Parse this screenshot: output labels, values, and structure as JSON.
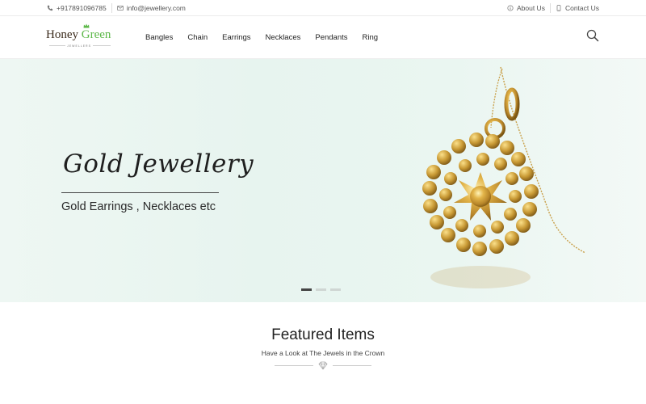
{
  "topbar": {
    "phone": "+917891096785",
    "email": "info@jewellery.com",
    "about": "About Us",
    "contact": "Contact Us"
  },
  "brand": {
    "name_part1": "Honey",
    "name_part2": "Green",
    "tagline": "JEWELLERS",
    "primary_color": "#5cb848",
    "dark_color": "#3b2b1c"
  },
  "nav": {
    "items": [
      "Bangles",
      "Chain",
      "Earrings",
      "Necklaces",
      "Pendants",
      "Ring"
    ]
  },
  "hero": {
    "title": "Gold Jewellery",
    "subtitle": "Gold Earrings , Necklaces etc",
    "slides": 3,
    "active_slide": 1
  },
  "featured": {
    "heading": "Featured Items",
    "tagline": "Have a Look at The Jewels in the Crown"
  }
}
